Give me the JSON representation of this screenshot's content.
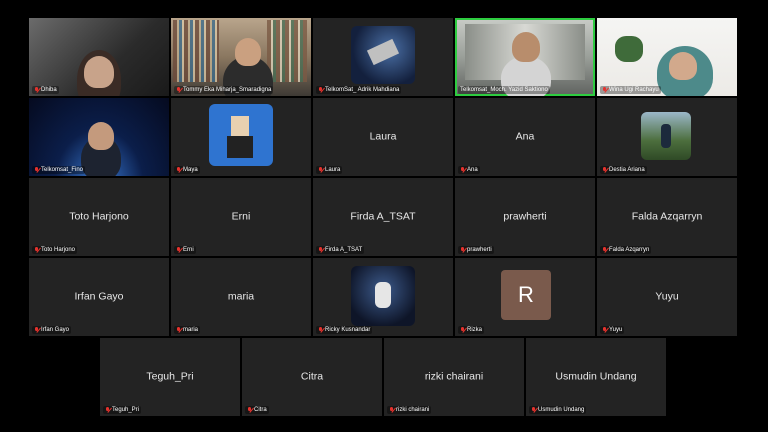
{
  "row_tiles": [
    {
      "name": "Dhiba",
      "center": "",
      "type": "video"
    },
    {
      "name": "Tommy Eka Miharja_Smaradigna",
      "center": "",
      "type": "video"
    },
    {
      "name": "TelkomSat_ Adrik Mahdiana",
      "center": "",
      "type": "image"
    },
    {
      "name": "Telkomsat_Moch. Yazid Saktiono",
      "center": "",
      "type": "video"
    },
    {
      "name": "Wina Ugi Rachayu",
      "center": "",
      "type": "video"
    },
    {
      "name": "Telkomsat_Fino",
      "center": "",
      "type": "video"
    },
    {
      "name": "Maya",
      "center": "",
      "type": "image"
    },
    {
      "name": "Laura",
      "center": "Laura",
      "type": "name"
    },
    {
      "name": "Ana",
      "center": "Ana",
      "type": "name"
    },
    {
      "name": "Destia Ariana",
      "center": "",
      "type": "image"
    },
    {
      "name": "Toto Harjono",
      "center": "Toto Harjono",
      "type": "name"
    },
    {
      "name": "Erni",
      "center": "Erni",
      "type": "name"
    },
    {
      "name": "Firda A_TSAT",
      "center": "Firda A_TSAT",
      "type": "name"
    },
    {
      "name": "prawherti",
      "center": "prawherti",
      "type": "name"
    },
    {
      "name": "Falda Azqarryn",
      "center": "Falda Azqarryn",
      "type": "name"
    },
    {
      "name": "Irfan Gayo",
      "center": "Irfan Gayo",
      "type": "name"
    },
    {
      "name": "maria",
      "center": "maria",
      "type": "name"
    },
    {
      "name": "Ricky Kusnandar",
      "center": "",
      "type": "image"
    },
    {
      "name": "Rizka",
      "center": "",
      "type": "avatar",
      "initial": "R"
    },
    {
      "name": "Yuyu",
      "center": "Yuyu",
      "type": "name"
    }
  ],
  "bottom_tiles": [
    {
      "name": "Teguh_Pri",
      "center": "Teguh_Pri"
    },
    {
      "name": "Citra",
      "center": "Citra"
    },
    {
      "name": "rizki chairani",
      "center": "rizki chairani"
    },
    {
      "name": "Usmudin Undang",
      "center": "Usmudin Undang"
    }
  ],
  "colors": {
    "tile_bg": "#232323",
    "active_speaker": "#2ecc40",
    "muted_mic": "#e5322d",
    "avatar_r": "#7a5a4c"
  },
  "icons": {
    "muted": "mic-off-icon"
  }
}
